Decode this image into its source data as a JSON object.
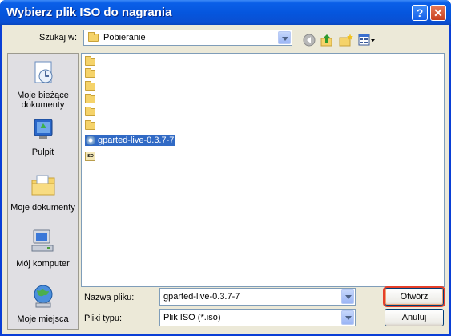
{
  "window": {
    "title": "Wybierz plik ISO do nagrania",
    "help_glyph": "?",
    "close_glyph": "✕"
  },
  "lookin": {
    "label": "Szukaj w:",
    "value": "Pobieranie"
  },
  "places": [
    {
      "label": "Moje bieżące dokumenty",
      "icon": "recent-documents-icon"
    },
    {
      "label": "Pulpit",
      "icon": "desktop-icon"
    },
    {
      "label": "Moje dokumenty",
      "icon": "my-documents-icon"
    },
    {
      "label": "Mój komputer",
      "icon": "my-computer-icon"
    },
    {
      "label": "Moje miejsca",
      "icon": "network-places-icon"
    }
  ],
  "files": {
    "folders_count_note": "",
    "selected_file": "gparted-live-0.3.7-7",
    "iso_badge": "ISO"
  },
  "filename": {
    "label": "Nazwa pliku:",
    "value": "gparted-live-0.3.7-7"
  },
  "filetype": {
    "label": "Pliki typu:",
    "value": "Plik ISO (*.iso)"
  },
  "buttons": {
    "open": "Otwórz",
    "cancel": "Anuluj"
  },
  "colors": {
    "title_blue": "#0556de",
    "selection": "#316ac5",
    "focus_red": "#e53f2a"
  }
}
